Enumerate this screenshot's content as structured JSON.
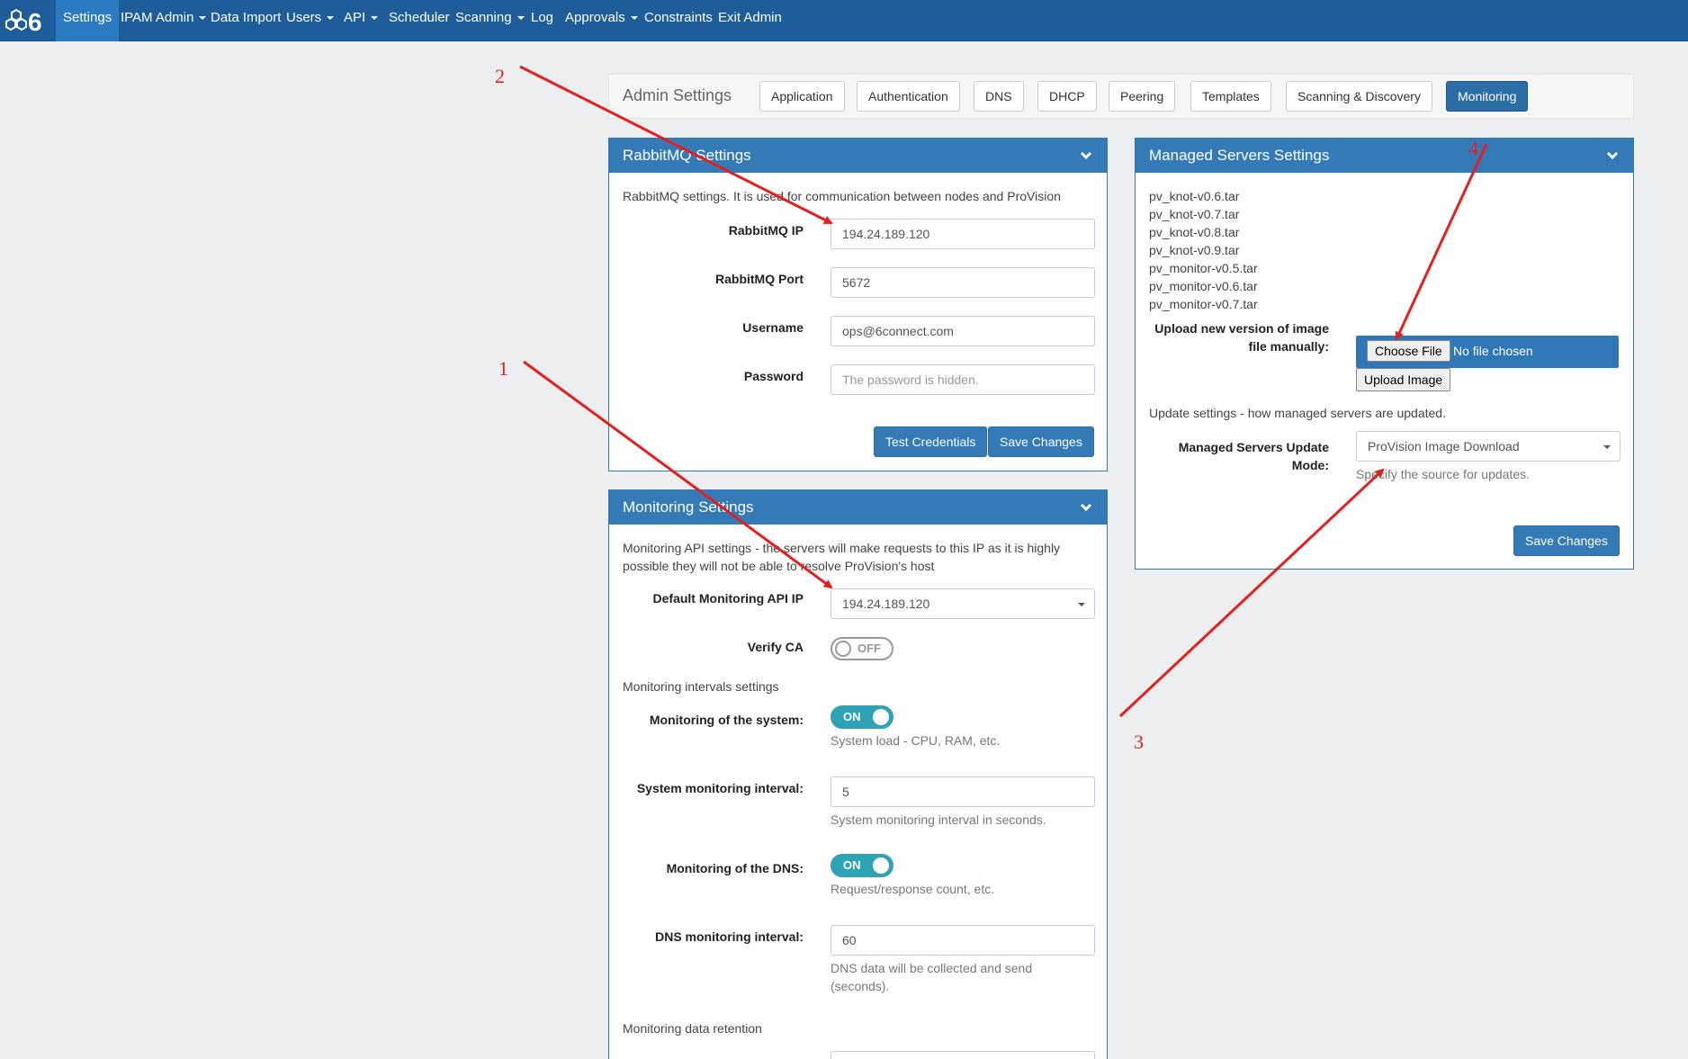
{
  "nav": {
    "items": [
      {
        "label": "Settings",
        "dropdown": false
      },
      {
        "label": "IPAM Admin",
        "dropdown": true
      },
      {
        "label": "Data Import",
        "dropdown": false
      },
      {
        "label": "Users",
        "dropdown": true
      },
      {
        "label": "API",
        "dropdown": true
      },
      {
        "label": "Scheduler",
        "dropdown": false
      },
      {
        "label": "Scanning",
        "dropdown": true
      },
      {
        "label": "Log",
        "dropdown": false
      },
      {
        "label": "Approvals",
        "dropdown": true
      },
      {
        "label": "Constraints",
        "dropdown": false
      },
      {
        "label": "Exit Admin",
        "dropdown": false
      }
    ]
  },
  "admin_settings": {
    "title": "Admin Settings",
    "tabs": [
      "Application",
      "Authentication",
      "DNS",
      "DHCP",
      "Peering",
      "Templates",
      "Scanning & Discovery",
      "Monitoring"
    ],
    "active_tab": "Monitoring"
  },
  "rabbitmq": {
    "title": "RabbitMQ Settings",
    "description": "RabbitMQ settings. It is used for communication between nodes and ProVision",
    "ip_label": "RabbitMQ IP",
    "ip_value": "194.24.189.120",
    "port_label": "RabbitMQ Port",
    "port_value": "5672",
    "username_label": "Username",
    "username_value": "ops@6connect.com",
    "password_label": "Password",
    "password_placeholder": "The password is hidden.",
    "test_button": "Test Credentials",
    "save_button": "Save Changes"
  },
  "monitoring": {
    "title": "Monitoring Settings",
    "description_line1": "Monitoring API settings - the servers will make requests to this IP as it is highly",
    "description_line2": "possible they will not be able to resolve ProVision's host",
    "api_ip_label": "Default Monitoring API IP",
    "api_ip_value": "194.24.189.120",
    "verify_ca_label": "Verify CA",
    "verify_ca_state": "OFF",
    "intervals_heading": "Monitoring intervals settings",
    "system_label": "Monitoring of the system:",
    "system_state": "ON",
    "system_help": "System load - CPU, RAM, etc.",
    "system_interval_label": "System monitoring interval:",
    "system_interval_value": "5",
    "system_interval_help": "System monitoring interval in seconds.",
    "dns_label": "Monitoring of the DNS:",
    "dns_state": "ON",
    "dns_help": "Request/response count, etc.",
    "dns_interval_label": "DNS monitoring interval:",
    "dns_interval_value": "60",
    "dns_interval_help_line1": "DNS data will be collected and send",
    "dns_interval_help_line2": "(seconds).",
    "retention_heading": "Monitoring data retention"
  },
  "managed_servers": {
    "title": "Managed Servers Settings",
    "images": [
      "pv_knot-v0.6.tar",
      "pv_knot-v0.7.tar",
      "pv_knot-v0.8.tar",
      "pv_knot-v0.9.tar",
      "pv_monitor-v0.5.tar",
      "pv_monitor-v0.6.tar",
      "pv_monitor-v0.7.tar"
    ],
    "upload_label_line1": "Upload new version of image",
    "upload_label_line2": "file manually:",
    "choose_file_button": "Choose File",
    "no_file_text": "No file chosen",
    "upload_button": "Upload Image",
    "update_description": "Update settings - how managed servers are updated.",
    "update_mode_label_line1": "Managed Servers Update",
    "update_mode_label_line2": "Mode:",
    "update_mode_value": "ProVision Image Download",
    "update_mode_help": "Specify the source for updates.",
    "save_button": "Save Changes"
  },
  "annotations": [
    "1",
    "2",
    "3",
    "4"
  ],
  "colors": {
    "nav": "#1c5d9a",
    "primary": "#337ab7",
    "toggle_on": "#2ea3b6",
    "annotation": "#e32020"
  }
}
